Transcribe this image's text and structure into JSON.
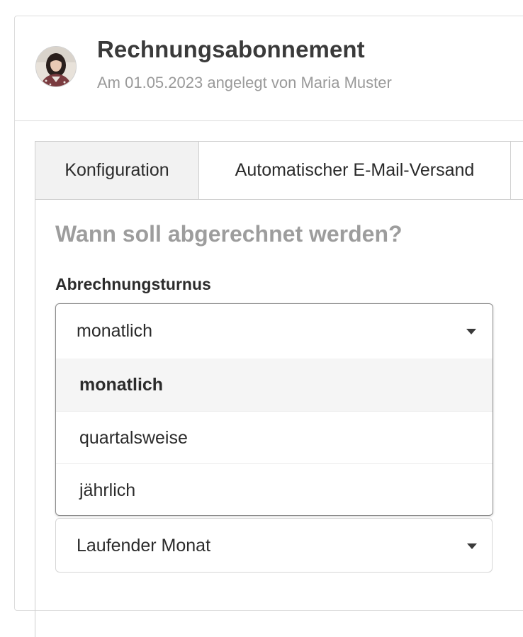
{
  "header": {
    "title": "Rechnungsabonnement",
    "subtitle": "Am 01.05.2023 angelegt von Maria Muster",
    "avatar_icon": "user-avatar"
  },
  "tabs": [
    {
      "label": "Konfiguration",
      "active": true
    },
    {
      "label": "Automatischer E-Mail-Versand",
      "active": false
    }
  ],
  "section": {
    "heading": "Wann soll abgerechnet werden?"
  },
  "billing_cycle": {
    "label": "Abrechnungsturnus",
    "value": "monatlich",
    "options": [
      "monatlich",
      "quartalsweise",
      "jährlich"
    ],
    "highlighted_option": "monatlich"
  },
  "second_select": {
    "value": "Laufender Monat"
  },
  "colors": {
    "heading_gray": "#9d9d9d",
    "subtitle_gray": "#9a9a9a",
    "active_tab_bg": "#f2f2f2",
    "highlight_bg": "#f5f5f5"
  }
}
